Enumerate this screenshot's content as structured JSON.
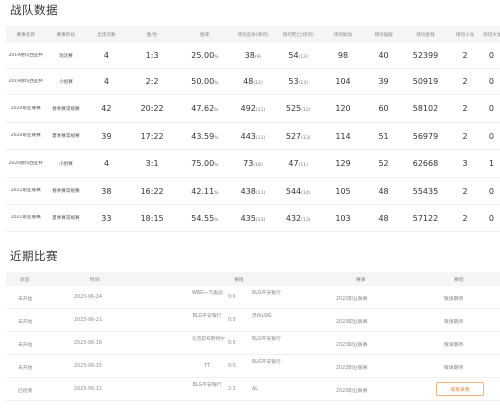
{
  "stats_title": "战队数据",
  "recent_title": "近期比赛",
  "stats_headers": [
    "赛事名称",
    "赛事阶段",
    "出场次数",
    "胜/负",
    "胜率",
    "场均击杀(场均)",
    "场均死亡(场均)",
    "场均助攻",
    "场均插眼",
    "场均金钱",
    "场均小龙",
    "场均大龙"
  ],
  "stats_rows": [
    {
      "name": "2019德玛西亚杯",
      "type": "淘汰赛",
      "played": "4",
      "wl": "1:3",
      "rate": "25.00",
      "pct": "%",
      "kills": "38",
      "kills_avg": "(9)",
      "deaths": "54",
      "deaths_avg": "(13)",
      "assists": "98",
      "wards": "40",
      "gold": "52399",
      "dragon": "2",
      "baron": "0"
    },
    {
      "name": "2019德玛西亚杯",
      "type": "小组赛",
      "played": "4",
      "wl": "2:2",
      "rate": "50.00",
      "pct": "%",
      "kills": "48",
      "kills_avg": "(12)",
      "deaths": "53",
      "deaths_avg": "(13)",
      "assists": "104",
      "wards": "39",
      "gold": "50919",
      "dragon": "2",
      "baron": "0"
    },
    {
      "name": "2020职业联赛",
      "type": "春季赛常规赛",
      "played": "42",
      "wl": "20:22",
      "rate": "47.62",
      "pct": "%",
      "kills": "492",
      "kills_avg": "(11)",
      "deaths": "525",
      "deaths_avg": "(12)",
      "assists": "120",
      "wards": "60",
      "gold": "58102",
      "dragon": "2",
      "baron": "0"
    },
    {
      "name": "2020职业联赛",
      "type": "夏季赛常规赛",
      "played": "39",
      "wl": "17:22",
      "rate": "43.59",
      "pct": "%",
      "kills": "443",
      "kills_avg": "(11)",
      "deaths": "527",
      "deaths_avg": "(13)",
      "assists": "114",
      "wards": "51",
      "gold": "56979",
      "dragon": "2",
      "baron": "0"
    },
    {
      "name": "2020德玛西亚杯",
      "type": "小组赛",
      "played": "4",
      "wl": "3:1",
      "rate": "75.00",
      "pct": "%",
      "kills": "73",
      "kills_avg": "(18)",
      "deaths": "47",
      "deaths_avg": "(11)",
      "assists": "129",
      "wards": "52",
      "gold": "62668",
      "dragon": "3",
      "baron": "1"
    },
    {
      "name": "2021职业联赛",
      "type": "春季赛常规赛",
      "played": "38",
      "wl": "16:22",
      "rate": "42.11",
      "pct": "%",
      "kills": "438",
      "kills_avg": "(11)",
      "deaths": "544",
      "deaths_avg": "(14)",
      "assists": "105",
      "wards": "48",
      "gold": "55435",
      "dragon": "2",
      "baron": "0"
    },
    {
      "name": "2021职业联赛",
      "type": "夏季赛常规赛",
      "played": "33",
      "wl": "18:15",
      "rate": "54.55",
      "pct": "%",
      "kills": "435",
      "kills_avg": "(13)",
      "deaths": "432",
      "deaths_avg": "(13)",
      "assists": "103",
      "wards": "48",
      "gold": "57122",
      "dragon": "2",
      "baron": "0"
    }
  ],
  "recent_headers": {
    "status": "状态",
    "time": "时间",
    "match": "赛程",
    "event": "赛事",
    "stage": "赛程"
  },
  "matches": [
    {
      "status": "未开始",
      "time": "2023-06-24",
      "team1": "WBG一汽奥迪",
      "score": "0:0",
      "team2": "BLG平安银行",
      "event": "2023职业联赛",
      "stage": "敬请期待",
      "button": ""
    },
    {
      "status": "未开始",
      "time": "2023-06-21",
      "team1": "BLG平安银行",
      "score": "0:0",
      "team2": "苏州LNG",
      "event": "2023职业联赛",
      "stage": "敬请期待",
      "button": ""
    },
    {
      "status": "未开始",
      "time": "2023-06-18",
      "team1": "北京JDG英特尔",
      "score": "0:0",
      "team2": "BLG平安银行",
      "event": "2023职业联赛",
      "stage": "敬请期待",
      "button": ""
    },
    {
      "status": "未开始",
      "time": "2023-06-15",
      "team1": "TT",
      "score": "0:0",
      "team2": "BLG平安银行",
      "event": "2023职业联赛",
      "stage": "敬请期待",
      "button": ""
    },
    {
      "status": "已结束",
      "time": "2023-06-12",
      "team1": "BLG平安银行",
      "score": "2:1",
      "team2": "AL",
      "event": "2023职业联赛",
      "stage": "",
      "button": "观看录像"
    }
  ]
}
